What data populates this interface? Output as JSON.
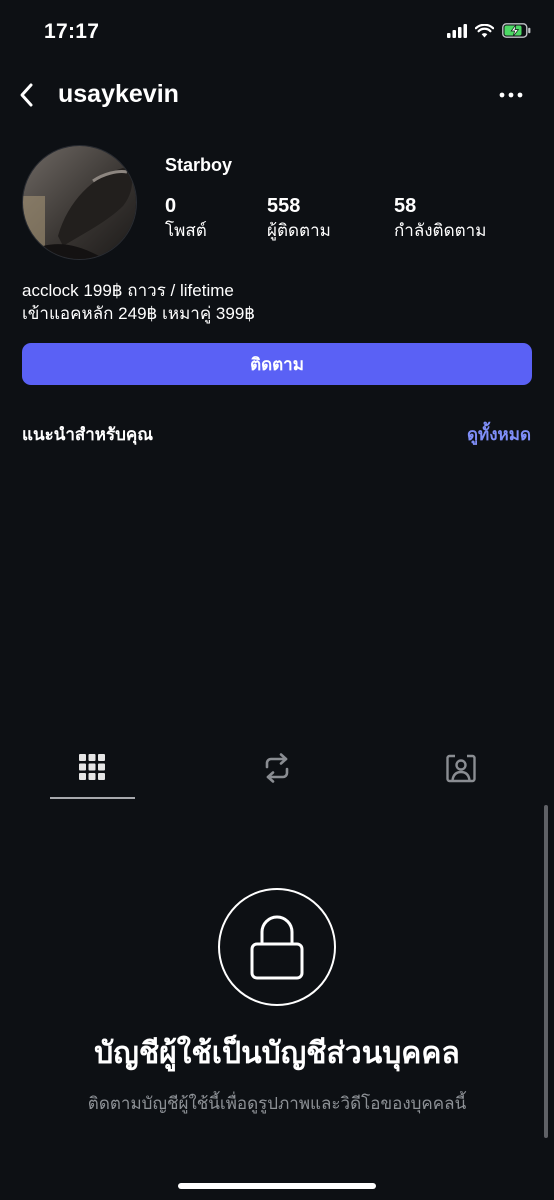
{
  "status_bar": {
    "time": "17:17",
    "icons": [
      "signal-icon",
      "wifi-icon",
      "battery-charging-icon"
    ]
  },
  "header": {
    "username": "usaykevin",
    "back_icon": "chevron-left-icon",
    "more_icon": "more-horizontal-icon"
  },
  "profile": {
    "display_name": "Starboy",
    "stats": {
      "posts": {
        "value": "0",
        "label": "โพสต์"
      },
      "followers": {
        "value": "558",
        "label": "ผู้ติดตาม"
      },
      "following": {
        "value": "58",
        "label": "กำลังติดตาม"
      }
    },
    "bio": {
      "line1": "acclock 199฿ ถาวร / lifetime",
      "line2": "เข้าแอคหลัก 249฿ เหมาคู่ 399฿"
    },
    "follow_button": "ติดตาม"
  },
  "suggestions": {
    "title": "แนะนำสำหรับคุณ",
    "see_all": "ดูทั้งหมด"
  },
  "tabs": [
    {
      "name": "posts-grid",
      "icon": "grid-icon",
      "active": true
    },
    {
      "name": "reposts",
      "icon": "repost-icon",
      "active": false
    },
    {
      "name": "tagged",
      "icon": "tagged-person-icon",
      "active": false
    }
  ],
  "private_account": {
    "icon": "lock-icon",
    "title": "บัญชีผู้ใช้เป็นบัญชีส่วนบุคคล",
    "subtitle": "ติดตามบัญชีผู้ใช้นี้เพื่อดูรูปภาพและวิดีโอของบุคคลนี้"
  },
  "colors": {
    "background": "#0d1014",
    "accent": "#5a61f5",
    "link": "#7f8ef8",
    "muted_text": "#8d9196"
  }
}
